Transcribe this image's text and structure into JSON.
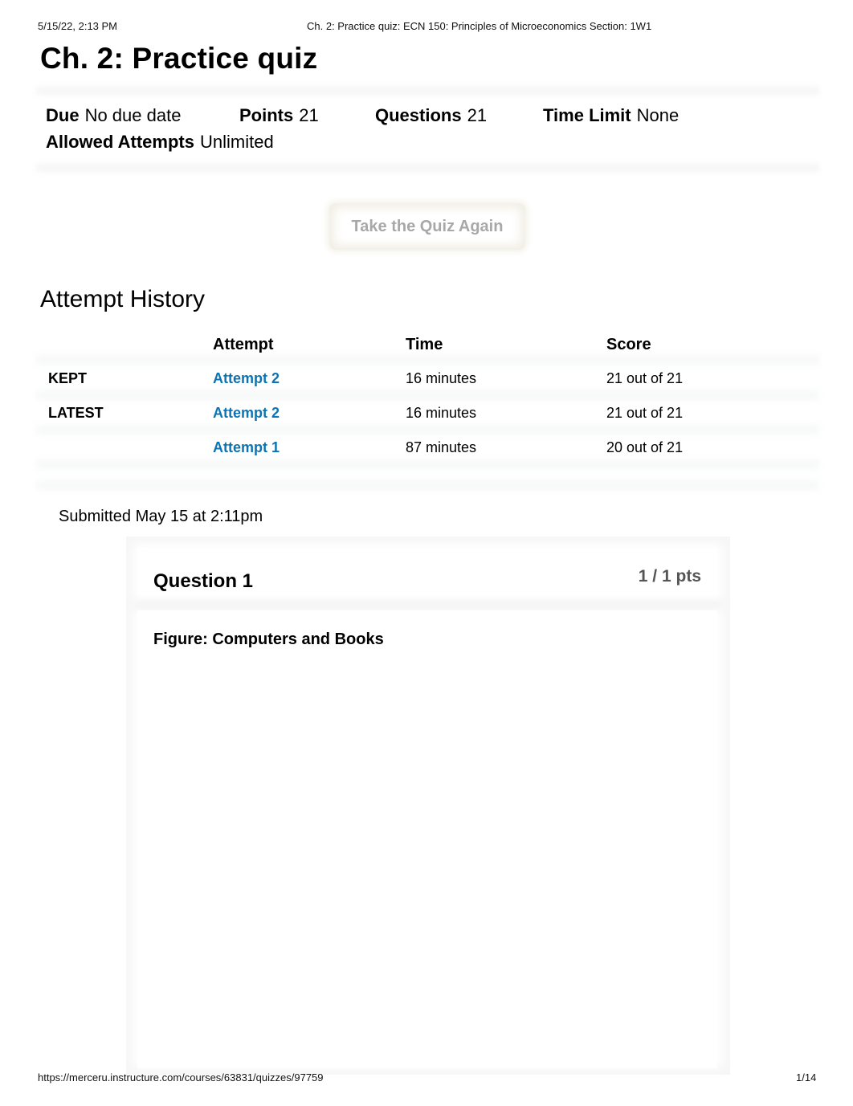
{
  "print_header": {
    "date": "5/15/22, 2:13 PM",
    "title": "Ch. 2: Practice quiz: ECN 150: Principles of Microeconomics Section: 1W1"
  },
  "page_title": "Ch. 2: Practice quiz",
  "meta": {
    "due": {
      "label": "Due",
      "value": "No due date"
    },
    "points": {
      "label": "Points",
      "value": "21"
    },
    "questions": {
      "label": "Questions",
      "value": "21"
    },
    "time_limit": {
      "label": "Time Limit",
      "value": "None"
    },
    "allowed_attempts": {
      "label": "Allowed Attempts",
      "value": "Unlimited"
    }
  },
  "retake_button": "Take the Quiz Again",
  "attempt_history": {
    "title": "Attempt History",
    "columns": [
      "",
      "Attempt",
      "Time",
      "Score"
    ],
    "rows": [
      {
        "tag": "KEPT",
        "attempt": "Attempt 2",
        "time": "16 minutes",
        "score": "21 out of 21"
      },
      {
        "tag": "LATEST",
        "attempt": "Attempt 2",
        "time": "16 minutes",
        "score": "21 out of 21"
      },
      {
        "tag": "",
        "attempt": "Attempt 1",
        "time": "87 minutes",
        "score": "20 out of 21"
      }
    ],
    "link_color": "#0b74b5"
  },
  "submitted": "Submitted May 15 at 2:11pm",
  "question": {
    "title": "Question 1",
    "points": "1 / 1 pts",
    "figure_title": "Figure: Computers and Books"
  },
  "print_footer": {
    "url": "https://merceru.instructure.com/courses/63831/quizzes/97759",
    "page": "1/14"
  }
}
